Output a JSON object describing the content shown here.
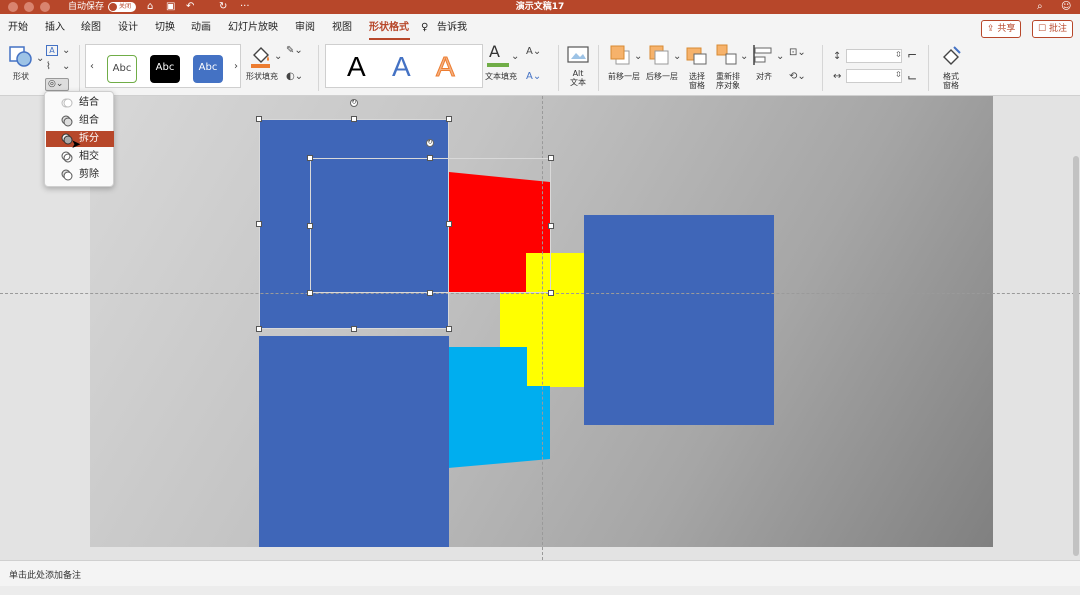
{
  "titlebar": {
    "autosave_label": "自动保存",
    "autosave_state": "关闭",
    "document_title": "演示文稿17",
    "icons": [
      "home-icon",
      "save-icon",
      "undo-icon",
      "redo-icon",
      "search-icon",
      "account-icon"
    ]
  },
  "ribbon_tabs": {
    "tabs": [
      "开始",
      "插入",
      "绘图",
      "设计",
      "切换",
      "动画",
      "幻灯片放映",
      "审阅",
      "视图",
      "形状格式"
    ],
    "active_tab": "形状格式",
    "tell_me": "告诉我",
    "share_label": "共享",
    "comments_label": "批注"
  },
  "ribbon": {
    "shape_label": "形状",
    "style_gallery": [
      "Abc",
      "Abc",
      "Abc"
    ],
    "shape_fill_label": "形状填充",
    "wordart_gallery": [
      "A",
      "A",
      "A"
    ],
    "text_fill_label": "文本填充",
    "alt_text_label": "Alt\n文本",
    "bring_forward_label": "前移一层",
    "send_backward_label": "后移一层",
    "selection_pane_label": "选择\n窗格",
    "reorder_label": "重新排\n序对象",
    "align_label": "对齐",
    "format_pane_label": "格式\n窗格",
    "colors": {
      "style_outline": "#70ad47",
      "style_black": "#000000",
      "style_blue": "#4472c4",
      "fill_bar": "#ed7d31",
      "text_fill_bar": "#70ad47",
      "wordart_blue": "#4472c4",
      "wordart_orange": "#f4b183"
    }
  },
  "merge_menu": {
    "items": [
      "结合",
      "组合",
      "拆分",
      "相交",
      "剪除"
    ],
    "highlighted": "拆分"
  },
  "slide": {
    "colors": {
      "blue": "#3f66b8",
      "red": "#ff0000",
      "yellow": "#ffff00",
      "cyan": "#00aeef"
    }
  },
  "notes": {
    "placeholder": "单击此处添加备注"
  }
}
